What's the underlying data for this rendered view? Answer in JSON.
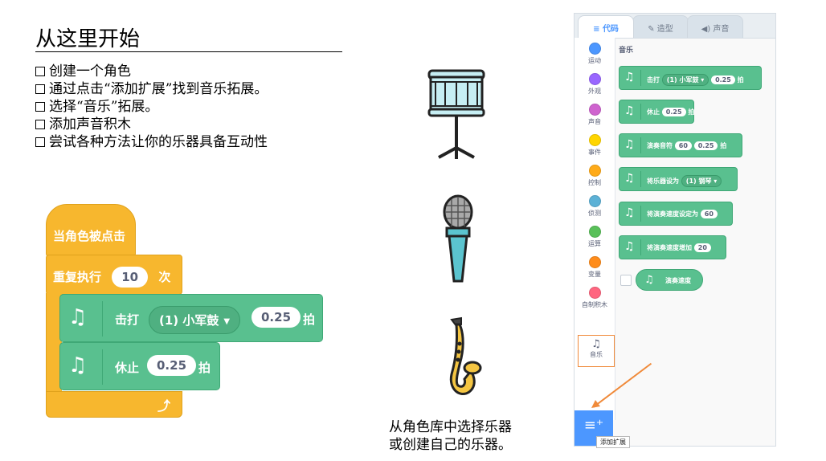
{
  "title": "从这里开始",
  "checklist": [
    "创建一个角色",
    "通过点击“添加扩展”找到音乐拓展。",
    "选择“音乐”拓展。",
    "添加声音积木",
    "尝试各种方法让你的乐器具备互动性"
  ],
  "script_blocks": {
    "hat": "当角色被点击",
    "repeat_label": "重复执行",
    "repeat_count": "10",
    "repeat_unit": "次",
    "play_drum_label": "击打",
    "play_drum_value": "(1) 小军鼓",
    "play_drum_beats": "0.25",
    "beat_unit": "拍",
    "rest_label": "休止",
    "rest_beats": "0.25",
    "rest_unit": "拍"
  },
  "caption": [
    "从角色库中选择乐器",
    "或创建自己的乐器。"
  ],
  "panel": {
    "tabs": [
      "代码",
      "造型",
      "声音"
    ],
    "categories": [
      "运动",
      "外观",
      "声音",
      "事件",
      "控制",
      "侦测",
      "运算",
      "变量",
      "自制积木"
    ],
    "category_colors": [
      "#4c97ff",
      "#9966ff",
      "#cf63cf",
      "#ffd500",
      "#ffab19",
      "#5cb1d6",
      "#59c059",
      "#ff8c1a",
      "#ff6680"
    ],
    "music_category": "音乐",
    "section_title": "音乐",
    "blocks": {
      "drum_label": "击打",
      "drum_value": "(1) 小军鼓",
      "drum_beats": "0.25",
      "drum_unit": "拍",
      "rest_label": "休止",
      "rest_beats": "0.25",
      "rest_unit": "拍",
      "note_label": "演奏音符",
      "note_value": "60",
      "note_beats": "0.25",
      "note_unit": "拍",
      "instrument_label": "将乐器设为",
      "instrument_value": "(1) 钢琴",
      "tempo_set_label": "将演奏速度设定为",
      "tempo_set_value": "60",
      "tempo_change_label": "将演奏速度增加",
      "tempo_change_value": "20",
      "tempo_reporter": "演奏速度"
    },
    "extension_tooltip": "添加扩展",
    "accent_color": "#4c97ff",
    "highlight_color": "#f08a3a"
  }
}
